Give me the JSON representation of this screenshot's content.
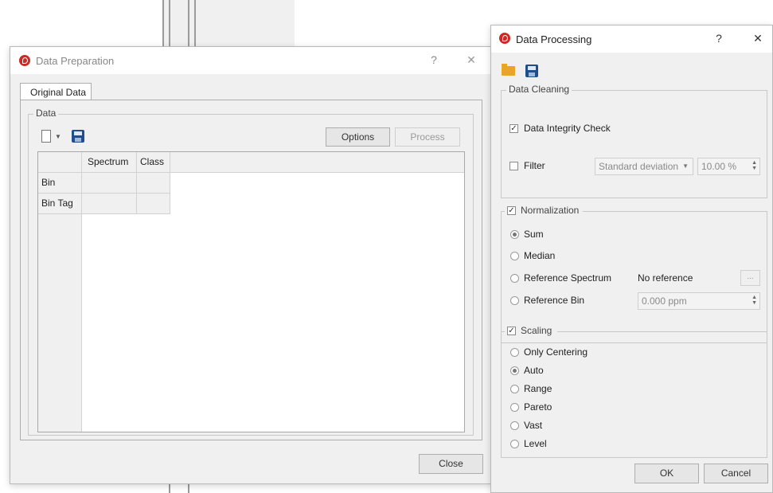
{
  "data_preparation": {
    "title": "Data Preparation",
    "help": "?",
    "close": "✕",
    "tab": "Original Data",
    "group_label": "Data",
    "options_label": "Options",
    "process_label": "Process",
    "columns": [
      "Spectrum",
      "Class"
    ],
    "rows": [
      "Bin",
      "Bin Tag"
    ],
    "close_button": "Close"
  },
  "data_processing": {
    "title": "Data Processing",
    "help": "?",
    "close": "✕",
    "cleaning": {
      "label": "Data Cleaning",
      "integrity": "Data Integrity Check",
      "filter": "Filter",
      "filter_method": "Standard deviation",
      "filter_value": "10.00 %"
    },
    "normalization": {
      "label": "Normalization",
      "sum": "Sum",
      "median": "Median",
      "ref_spectrum": "Reference Spectrum",
      "no_reference": "No reference",
      "browse": "...",
      "ref_bin": "Reference Bin",
      "ref_bin_value": "0.000 ppm"
    },
    "scaling": {
      "label": "Scaling",
      "options": [
        "Only Centering",
        "Auto",
        "Range",
        "Pareto",
        "Vast",
        "Level"
      ]
    },
    "ok": "OK",
    "cancel": "Cancel"
  }
}
